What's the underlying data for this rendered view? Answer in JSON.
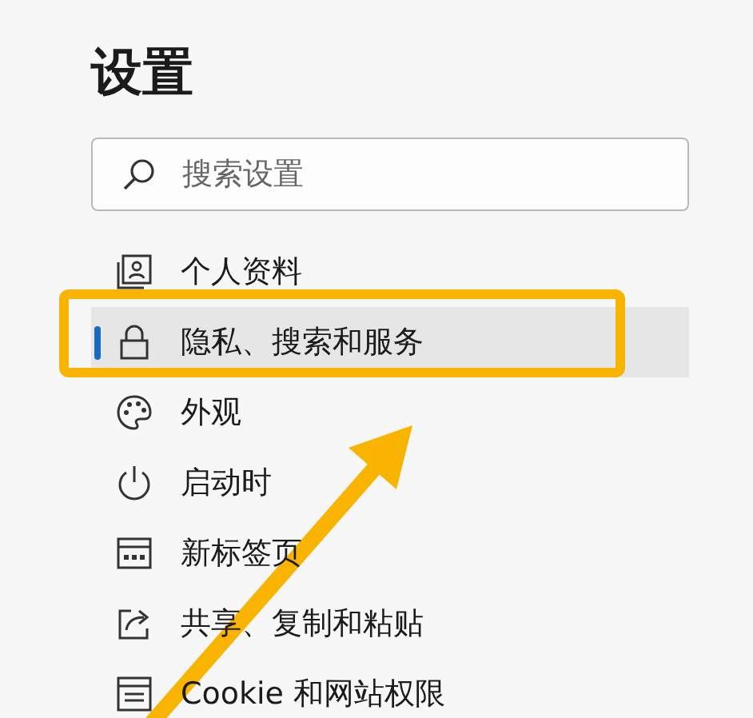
{
  "title": "设置",
  "search": {
    "placeholder": "搜索设置"
  },
  "menu": [
    {
      "label": "个人资料",
      "selected": false
    },
    {
      "label": "隐私、搜索和服务",
      "selected": true
    },
    {
      "label": "外观",
      "selected": false
    },
    {
      "label": "启动时",
      "selected": false
    },
    {
      "label": "新标签页",
      "selected": false
    },
    {
      "label": "共享、复制和粘贴",
      "selected": false
    },
    {
      "label": "Cookie 和网站权限",
      "selected": false
    }
  ]
}
